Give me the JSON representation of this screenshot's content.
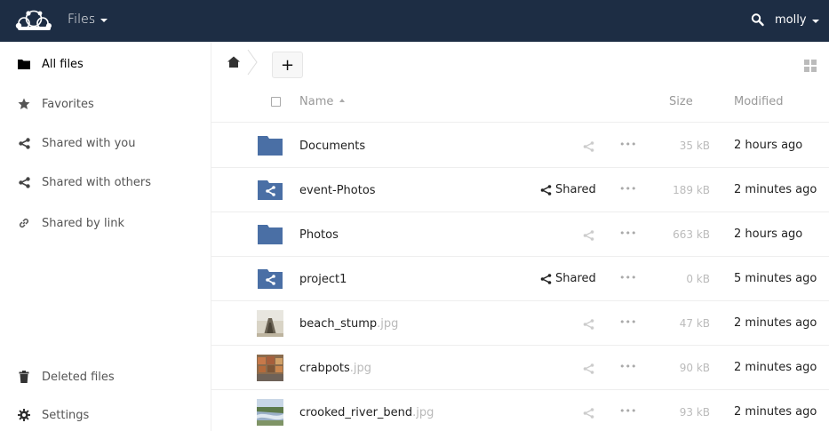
{
  "header": {
    "app_name": "Files",
    "user": "molly",
    "bg_color": "#1d2d44"
  },
  "sidebar": {
    "items": [
      {
        "label": "All files",
        "icon": "folder-icon",
        "active": true
      },
      {
        "label": "Favorites",
        "icon": "star-icon"
      },
      {
        "label": "Shared with you",
        "icon": "share-icon"
      },
      {
        "label": "Shared with others",
        "icon": "share-icon"
      },
      {
        "label": "Shared by link",
        "icon": "link-icon"
      }
    ],
    "bottom_items": [
      {
        "label": "Deleted files",
        "icon": "trash-icon"
      },
      {
        "label": "Settings",
        "icon": "gear-icon"
      }
    ]
  },
  "controls": {
    "new_label": "+"
  },
  "table": {
    "col_name": "Name",
    "col_size": "Size",
    "col_modified": "Modified"
  },
  "files": [
    {
      "name": "Documents",
      "ext": "",
      "type": "folder",
      "shared_label": "",
      "size": "35 kB",
      "modified": "2 hours ago"
    },
    {
      "name": "event-Photos",
      "ext": "",
      "type": "shared-folder",
      "shared_label": "Shared",
      "size": "189 kB",
      "modified": "2 minutes ago"
    },
    {
      "name": "Photos",
      "ext": "",
      "type": "folder",
      "shared_label": "",
      "size": "663 kB",
      "modified": "2 hours ago"
    },
    {
      "name": "project1",
      "ext": "",
      "type": "shared-folder",
      "shared_label": "Shared",
      "size": "0 kB",
      "modified": "5 minutes ago"
    },
    {
      "name": "beach_stump",
      "ext": ".jpg",
      "type": "image",
      "shared_label": "",
      "size": "47 kB",
      "modified": "2 minutes ago"
    },
    {
      "name": "crabpots",
      "ext": ".jpg",
      "type": "image",
      "shared_label": "",
      "size": "90 kB",
      "modified": "2 minutes ago"
    },
    {
      "name": "crooked_river_bend",
      "ext": ".jpg",
      "type": "image",
      "shared_label": "",
      "size": "93 kB",
      "modified": "2 minutes ago"
    }
  ],
  "more_label": "•••",
  "colors": {
    "folder": "#4a6fa5",
    "header": "#1d2d44"
  }
}
